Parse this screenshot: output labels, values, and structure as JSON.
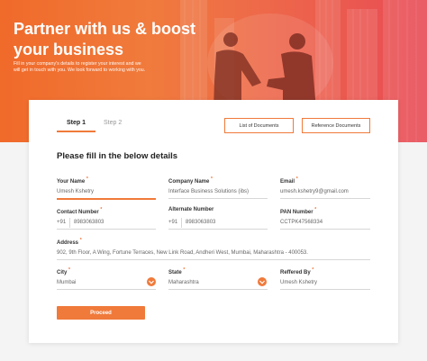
{
  "hero": {
    "title": "Partner with us & boost your business",
    "subtitle": "Fill in your company's details to register your interest and we will get in touch with you. We look forward to working with you."
  },
  "steps": [
    "Step 1",
    "Step 2"
  ],
  "buttons": {
    "list_documents": "List of Documents",
    "reference_documents": "Reference Documents",
    "proceed": "Proceed"
  },
  "form": {
    "heading": "Please fill in the below details",
    "your_name": {
      "label": "Your Name",
      "value": "Umesh Kshetry"
    },
    "company_name": {
      "label": "Company Name",
      "value": "Interface Business Solutions (ibs)"
    },
    "email": {
      "label": "Email",
      "value": "umesh.kshetry9@gmail.com"
    },
    "contact_number": {
      "label": "Contact Number",
      "prefix": "+91",
      "value": "8983063803"
    },
    "alternate_number": {
      "label": "Alternate Number",
      "prefix": "+91",
      "value": "8983063803"
    },
    "pan_number": {
      "label": "PAN Number",
      "value": "CCTPK47568334"
    },
    "address": {
      "label": "Address",
      "value": "902, 9th Floor, A Wing, Fortune Terraces, New Link Road, Andheri West, Mumbai, Maharashtra - 400053."
    },
    "city": {
      "label": "City",
      "value": "Mumbai"
    },
    "state": {
      "label": "State",
      "value": "Maharashtra"
    },
    "referred_by": {
      "label": "Reffered By",
      "value": "Umesh Kshetry"
    }
  },
  "colors": {
    "accent": "#f07a3a",
    "hero_start": "#f06a2a",
    "hero_end": "#e84a55"
  },
  "icons": {
    "dropdown": "chevron-down-icon"
  }
}
